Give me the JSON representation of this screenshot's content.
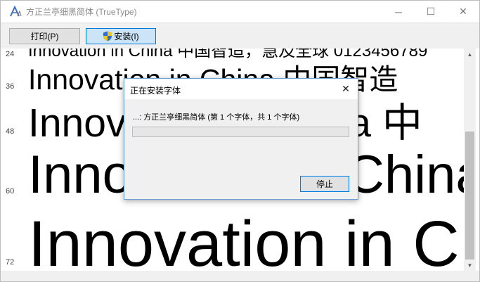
{
  "window": {
    "title": "方正兰亭细黑简体 (TrueType)",
    "app_icon": "font-viewer-icon",
    "controls": {
      "minimize": "─",
      "maximize": "☐",
      "close": "✕"
    }
  },
  "toolbar": {
    "print_label": "打印(P)",
    "install_label": "安装(I)",
    "install_icon": "shield-icon"
  },
  "preview": {
    "rows": [
      {
        "size": "24",
        "text": "Innovation in China 中国智造，慧及全球 0123456789"
      },
      {
        "size": "36",
        "text": "Innovation in China 中国智造"
      },
      {
        "size": "48",
        "text": "Innovation in China 中"
      },
      {
        "size": "60",
        "text": "Innovation in China"
      },
      {
        "size": "72",
        "text": "Innovation in China"
      }
    ]
  },
  "dialog": {
    "title": "正在安装字体",
    "status": "...: 方正兰亭细黑简体 (第 1 个字体，共 1 个字体)",
    "progress": 0,
    "stop_label": "停止",
    "close_glyph": "✕"
  },
  "colors": {
    "accent": "#0078d7",
    "progress_fill": "#06b025",
    "title_text": "#8a8a8a"
  }
}
